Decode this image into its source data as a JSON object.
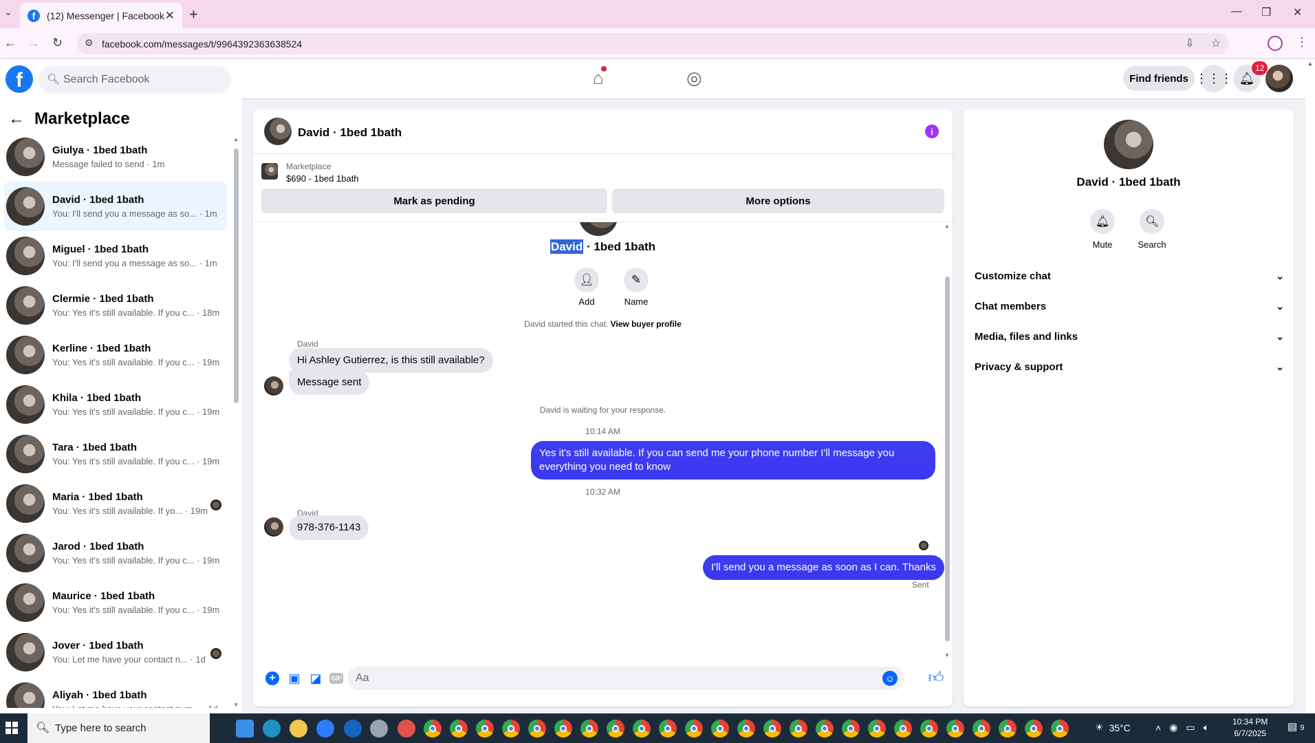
{
  "browser": {
    "tab_title": "(12) Messenger | Facebook",
    "url": "facebook.com/messages/t/9964392363638524"
  },
  "header": {
    "search_placeholder": "Search Facebook",
    "find_friends": "Find friends",
    "notifications_count": "12"
  },
  "sidebar": {
    "title": "Marketplace",
    "conversations": [
      {
        "name": "Giulya · 1bed 1bath",
        "preview": "Message failed to send · 1m",
        "active": false,
        "seen": false
      },
      {
        "name": "David · 1bed 1bath",
        "preview": "You: I'll send you a message as so... · 1m",
        "active": true,
        "seen": false
      },
      {
        "name": "Miguel · 1bed 1bath",
        "preview": "You: I'll send you a message as so... · 1m",
        "active": false,
        "seen": false
      },
      {
        "name": "Clermie · 1bed 1bath",
        "preview": "You: Yes it's still available. If you c... · 18m",
        "active": false,
        "seen": false
      },
      {
        "name": "Kerline · 1bed 1bath",
        "preview": "You: Yes it's still available. If you c... · 19m",
        "active": false,
        "seen": false
      },
      {
        "name": "Khila · 1bed 1bath",
        "preview": "You: Yes it's still available. If you c... · 19m",
        "active": false,
        "seen": false
      },
      {
        "name": "Tara · 1bed 1bath",
        "preview": "You: Yes it's still available. If you c... · 19m",
        "active": false,
        "seen": false
      },
      {
        "name": "Maria · 1bed 1bath",
        "preview": "You: Yes it's still available. If yo... · 19m",
        "active": false,
        "seen": true
      },
      {
        "name": "Jarod · 1bed 1bath",
        "preview": "You: Yes it's still available. If you c... · 19m",
        "active": false,
        "seen": false
      },
      {
        "name": "Maurice · 1bed 1bath",
        "preview": "You: Yes it's still available. If you c... · 19m",
        "active": false,
        "seen": false
      },
      {
        "name": "Jover · 1bed 1bath",
        "preview": "You: Let me have your contact n... · 1d",
        "active": false,
        "seen": true
      },
      {
        "name": "Aliyah · 1bed 1bath",
        "preview": "You: Let me have your contact num... · 1d",
        "active": false,
        "seen": false
      }
    ]
  },
  "chat": {
    "title": "David · 1bed 1bath",
    "listing_source": "Marketplace",
    "listing_title": "$690 - 1bed 1bath",
    "mark_pending": "Mark as pending",
    "more_options": "More options",
    "profile_name_highlight": "David",
    "profile_name_rest": " · 1bed 1bath",
    "add_label": "Add",
    "name_label": "Name",
    "started_text": "David started this chat.",
    "view_buyer_profile": "View buyer profile",
    "sender_1": "David",
    "msg_in_1": "Hi Ashley Gutierrez, is this still available?",
    "msg_in_2": "Message sent",
    "waiting_text": "David is waiting for your response.",
    "time_1": "10:14 AM",
    "msg_out_1": "Yes it's still available. If you can send me your phone number I'll message you everything you need to know",
    "time_2": "10:32 AM",
    "sender_2": "David",
    "msg_in_3": "978-376-1143",
    "msg_out_2": "I'll send you a message as soon as I can. Thanks",
    "sent_status": "Sent",
    "composer_placeholder": "Aa"
  },
  "info_panel": {
    "name": "David · 1bed 1bath",
    "mute": "Mute",
    "search": "Search",
    "sections": [
      "Customize chat",
      "Chat members",
      "Media, files and links",
      "Privacy & support"
    ]
  },
  "taskbar": {
    "search_placeholder": "Type here to search",
    "temperature": "35°C",
    "time": "10:34 PM",
    "date": "6/7/2025",
    "notification_count": "9"
  }
}
